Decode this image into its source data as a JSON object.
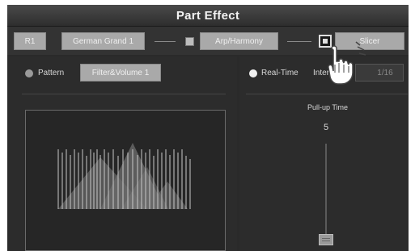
{
  "title": "Part Effect",
  "toolbar": {
    "part": "R1",
    "voice": "German Grand 1",
    "arp_label": "Arp/Harmony",
    "arp_checked": false,
    "slicer_label": "Slicer",
    "slicer_checked": true
  },
  "left_panel": {
    "pattern_label": "Pattern",
    "pattern_value": "Filter&Volume 1",
    "pattern_selected": false
  },
  "right_panel": {
    "realtime_label": "Real-Time",
    "interval_label": "Interv",
    "interval_value": "1/16",
    "realtime_selected": true,
    "pullup_label": "Pull-up Time",
    "pullup_value": "5"
  },
  "colors": {
    "screen_bg": "#2a2a2a",
    "button_gray": "#a9a9a9",
    "text": "#d8d8d8",
    "radio_on": "#f0f0f0",
    "radio_off": "#9a9a9a"
  },
  "icons": [
    "checkbox-icon",
    "hand-pointer-icon",
    "radio-icon"
  ]
}
